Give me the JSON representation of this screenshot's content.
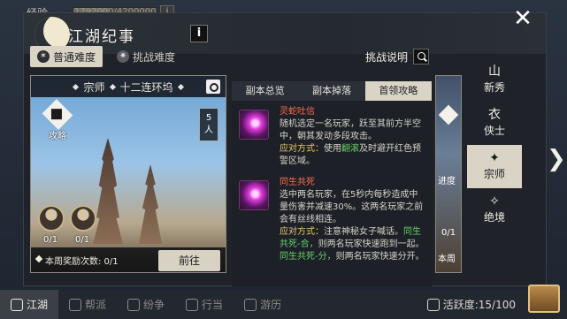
{
  "hud": {
    "exp_label": "经验",
    "exp_text": "1792000/4200000",
    "exp_progress": 0.43,
    "info_glyph": "i"
  },
  "panel": {
    "title": "江湖纪事",
    "info_glyph": "i",
    "close_glyph": "✕"
  },
  "difficulty": {
    "normal": "普通难度",
    "challenge": "挑战难度",
    "desc": "挑战说明"
  },
  "card": {
    "title_left": "宗师",
    "title_right": "十二连环坞",
    "guide_label": "攻略",
    "players_num": "5",
    "players_unit": "人",
    "boss_counts": [
      "0/1",
      "0/1"
    ],
    "reward_text": "本周奖励次数: 0/1",
    "go_button": "前往"
  },
  "mid_tabs": [
    "副本总览",
    "副本掉落",
    "首领攻略"
  ],
  "skills": [
    {
      "name": "灵蛇吐信",
      "desc": "随机选定一名玩家，跃至其前方半空中，朝其发动多段攻击。",
      "counter_label": "应对方式：",
      "counter_pre": "使用",
      "counter_hl": "翻滚",
      "counter_post": "及时避开红色预警区域。"
    },
    {
      "name": "同生共死",
      "desc": "选中两名玩家，在5秒内每秒造成中量伤害并减速30%。这两名玩家之前会有丝线相连。",
      "counter_label": "应对方式：",
      "counter_pre": "注意神秘女子喊话。",
      "counter_hl": "同生共死-合，",
      "counter_mid": "则两名玩家快速跑到一起。",
      "counter_hl2": "同生共死-分，",
      "counter_post": "则两名玩家快速分开。"
    }
  ],
  "thumb2": {
    "progress_label": "进度",
    "count": "0/1",
    "week_label": "本周"
  },
  "ranks": [
    {
      "glyph": "山",
      "label": "新秀"
    },
    {
      "glyph": "衣",
      "label": "侠士"
    },
    {
      "glyph": "✦",
      "label": "宗师"
    },
    {
      "glyph": "✧",
      "label": "绝境"
    }
  ],
  "arrow_glyph": "❯",
  "bottom": {
    "items": [
      "江湖",
      "帮派",
      "纷争",
      "行当",
      "游历"
    ],
    "activity": "活跃度:15/100"
  },
  "icons": {
    "moon": "moon-icon",
    "camera": "camera-icon",
    "search": "search-icon"
  }
}
